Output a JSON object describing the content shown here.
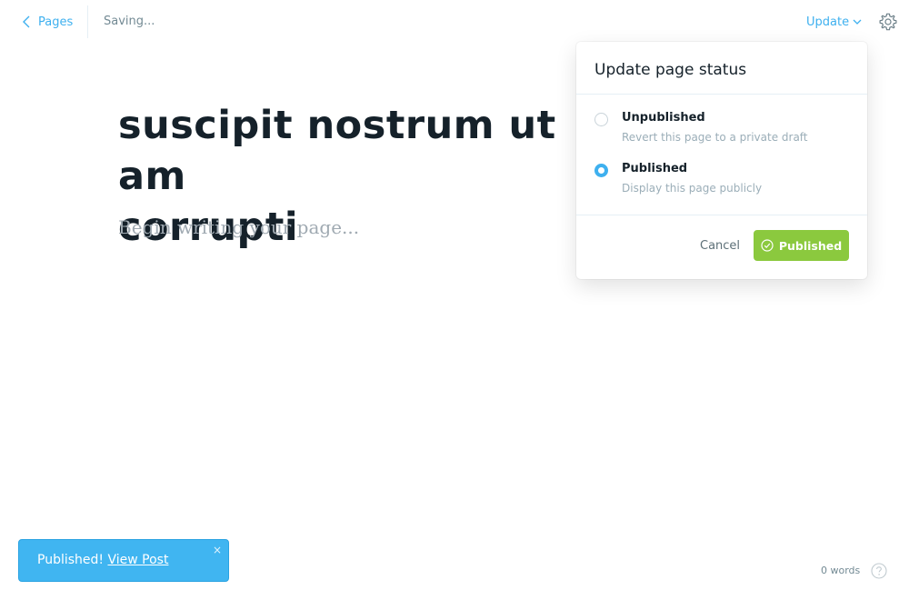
{
  "header": {
    "back_label": "Pages",
    "status_text": "Saving...",
    "update_label": "Update",
    "icons": {
      "back": "chevron-left-icon",
      "update_caret": "chevron-down-icon",
      "settings": "gear-icon"
    }
  },
  "editor": {
    "title": "suscipit nostrum ut am\ncorrupti",
    "body_placeholder": "Begin writing your page..."
  },
  "publish_popover": {
    "title": "Update page status",
    "options": [
      {
        "label": "Unpublished",
        "description": "Revert this page to a private draft",
        "selected": false
      },
      {
        "label": "Published",
        "description": "Display this page publicly",
        "selected": true
      }
    ],
    "cancel_label": "Cancel",
    "confirm_label": "Published",
    "confirm_icon": "check-circle-icon"
  },
  "notification": {
    "message": "Published!",
    "link_label": "View Post",
    "close_symbol": "×"
  },
  "footer": {
    "word_count": "0 words",
    "help_icon": "help-icon"
  },
  "colors": {
    "accent_blue": "#3eb0ef",
    "publish_green": "#8bc93e",
    "toast_blue": "#40b5f1",
    "title_dark": "#15212a"
  }
}
